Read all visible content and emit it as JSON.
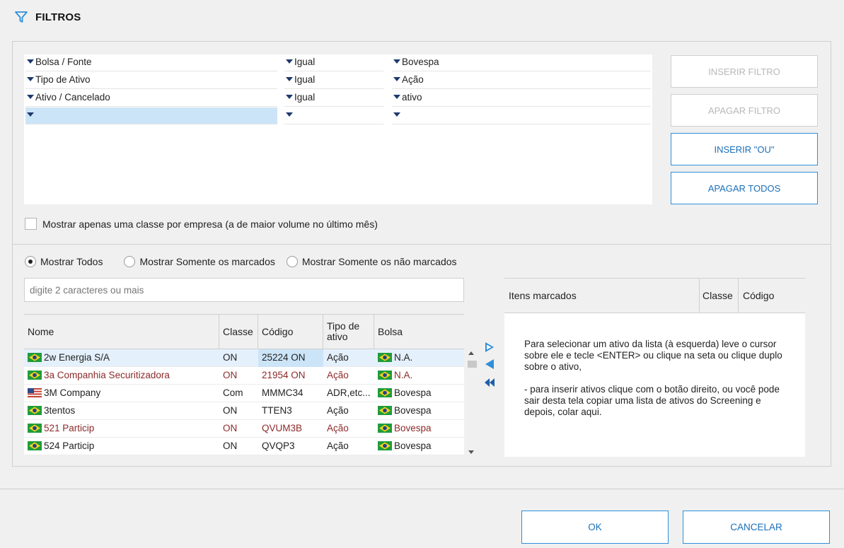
{
  "header": {
    "title": "FILTROS",
    "icon": "filter-icon"
  },
  "filters": [
    {
      "field": "Bolsa / Fonte",
      "op": "Igual",
      "value": "Bovespa"
    },
    {
      "field": "Tipo de Ativo",
      "op": "Igual",
      "value": "Ação"
    },
    {
      "field": "Ativo / Cancelado",
      "op": "Igual",
      "value": "ativo"
    },
    {
      "field": "",
      "op": "",
      "value": ""
    }
  ],
  "buttons": {
    "insert_filter": "INSERIR FILTRO",
    "delete_filter": "APAGAR FILTRO",
    "insert_or": "INSERIR \"OU\"",
    "delete_all": "APAGAR TODOS"
  },
  "one_class_checkbox": {
    "label": "Mostrar apenas uma classe por empresa (a de maior volume no último mês)",
    "checked": false
  },
  "radios": {
    "show_all": "Mostrar Todos",
    "show_marked": "Mostrar Somente os marcados",
    "show_unmarked": "Mostrar Somente os não marcados",
    "selected": "show_all"
  },
  "search": {
    "placeholder": "digite 2 caracteres ou mais",
    "value": ""
  },
  "grid": {
    "headers": {
      "nome": "Nome",
      "classe": "Classe",
      "codigo": "Código",
      "tipo": "Tipo de ativo",
      "bolsa": "Bolsa"
    },
    "rows": [
      {
        "nome": "2w Energia S/A",
        "classe": "ON",
        "codigo": "25224 ON",
        "tipo": "Ação",
        "bolsa": "N.A.",
        "flag": "br",
        "bolsa_flag": "br"
      },
      {
        "nome": "3a Companhia Securitizadora",
        "classe": "ON",
        "codigo": "21954 ON",
        "tipo": "Ação",
        "bolsa": "N.A.",
        "flag": "br",
        "bolsa_flag": "br"
      },
      {
        "nome": "3M Company",
        "classe": "Com",
        "codigo": "MMMC34",
        "tipo": "ADR,etc...",
        "bolsa": "Bovespa",
        "flag": "us",
        "bolsa_flag": "br"
      },
      {
        "nome": "3tentos",
        "classe": "ON",
        "codigo": "TTEN3",
        "tipo": "Ação",
        "bolsa": "Bovespa",
        "flag": "br",
        "bolsa_flag": "br"
      },
      {
        "nome": "521 Particip",
        "classe": "ON",
        "codigo": "QVUM3B",
        "tipo": "Ação",
        "bolsa": "Bovespa",
        "flag": "br",
        "bolsa_flag": "br"
      },
      {
        "nome": "524 Particip",
        "classe": "ON",
        "codigo": "QVQP3",
        "tipo": "Ação",
        "bolsa": "Bovespa",
        "flag": "br",
        "bolsa_flag": "br"
      }
    ]
  },
  "marked": {
    "headers": {
      "itens": "Itens marcados",
      "classe": "Classe",
      "codigo": "Código"
    },
    "help_p1": "Para selecionar um ativo da lista (à esquerda) leve o cursor sobre ele e tecle <ENTER> ou clique na seta ou clique duplo sobre o ativo,",
    "help_p2": "- para inserir ativos clique com o botão direito, ou você pode sair desta tela copiar uma lista de ativos do Screening e depois, colar aqui."
  },
  "footer": {
    "ok": "OK",
    "cancel": "CANCELAR"
  },
  "colors": {
    "accent": "#2f8fd8",
    "selection": "#cce4f7",
    "row_highlight": "#e4f0fb",
    "red_text": "#8c2a2a"
  }
}
